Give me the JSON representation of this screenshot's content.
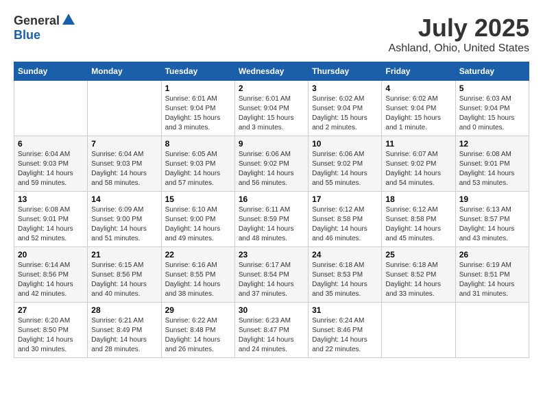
{
  "logo": {
    "general": "General",
    "blue": "Blue"
  },
  "title": "July 2025",
  "location": "Ashland, Ohio, United States",
  "weekdays": [
    "Sunday",
    "Monday",
    "Tuesday",
    "Wednesday",
    "Thursday",
    "Friday",
    "Saturday"
  ],
  "weeks": [
    [
      {
        "day": "",
        "sunrise": "",
        "sunset": "",
        "daylight": ""
      },
      {
        "day": "",
        "sunrise": "",
        "sunset": "",
        "daylight": ""
      },
      {
        "day": "1",
        "sunrise": "Sunrise: 6:01 AM",
        "sunset": "Sunset: 9:04 PM",
        "daylight": "Daylight: 15 hours and 3 minutes."
      },
      {
        "day": "2",
        "sunrise": "Sunrise: 6:01 AM",
        "sunset": "Sunset: 9:04 PM",
        "daylight": "Daylight: 15 hours and 3 minutes."
      },
      {
        "day": "3",
        "sunrise": "Sunrise: 6:02 AM",
        "sunset": "Sunset: 9:04 PM",
        "daylight": "Daylight: 15 hours and 2 minutes."
      },
      {
        "day": "4",
        "sunrise": "Sunrise: 6:02 AM",
        "sunset": "Sunset: 9:04 PM",
        "daylight": "Daylight: 15 hours and 1 minute."
      },
      {
        "day": "5",
        "sunrise": "Sunrise: 6:03 AM",
        "sunset": "Sunset: 9:04 PM",
        "daylight": "Daylight: 15 hours and 0 minutes."
      }
    ],
    [
      {
        "day": "6",
        "sunrise": "Sunrise: 6:04 AM",
        "sunset": "Sunset: 9:03 PM",
        "daylight": "Daylight: 14 hours and 59 minutes."
      },
      {
        "day": "7",
        "sunrise": "Sunrise: 6:04 AM",
        "sunset": "Sunset: 9:03 PM",
        "daylight": "Daylight: 14 hours and 58 minutes."
      },
      {
        "day": "8",
        "sunrise": "Sunrise: 6:05 AM",
        "sunset": "Sunset: 9:03 PM",
        "daylight": "Daylight: 14 hours and 57 minutes."
      },
      {
        "day": "9",
        "sunrise": "Sunrise: 6:06 AM",
        "sunset": "Sunset: 9:02 PM",
        "daylight": "Daylight: 14 hours and 56 minutes."
      },
      {
        "day": "10",
        "sunrise": "Sunrise: 6:06 AM",
        "sunset": "Sunset: 9:02 PM",
        "daylight": "Daylight: 14 hours and 55 minutes."
      },
      {
        "day": "11",
        "sunrise": "Sunrise: 6:07 AM",
        "sunset": "Sunset: 9:02 PM",
        "daylight": "Daylight: 14 hours and 54 minutes."
      },
      {
        "day": "12",
        "sunrise": "Sunrise: 6:08 AM",
        "sunset": "Sunset: 9:01 PM",
        "daylight": "Daylight: 14 hours and 53 minutes."
      }
    ],
    [
      {
        "day": "13",
        "sunrise": "Sunrise: 6:08 AM",
        "sunset": "Sunset: 9:01 PM",
        "daylight": "Daylight: 14 hours and 52 minutes."
      },
      {
        "day": "14",
        "sunrise": "Sunrise: 6:09 AM",
        "sunset": "Sunset: 9:00 PM",
        "daylight": "Daylight: 14 hours and 51 minutes."
      },
      {
        "day": "15",
        "sunrise": "Sunrise: 6:10 AM",
        "sunset": "Sunset: 9:00 PM",
        "daylight": "Daylight: 14 hours and 49 minutes."
      },
      {
        "day": "16",
        "sunrise": "Sunrise: 6:11 AM",
        "sunset": "Sunset: 8:59 PM",
        "daylight": "Daylight: 14 hours and 48 minutes."
      },
      {
        "day": "17",
        "sunrise": "Sunrise: 6:12 AM",
        "sunset": "Sunset: 8:58 PM",
        "daylight": "Daylight: 14 hours and 46 minutes."
      },
      {
        "day": "18",
        "sunrise": "Sunrise: 6:12 AM",
        "sunset": "Sunset: 8:58 PM",
        "daylight": "Daylight: 14 hours and 45 minutes."
      },
      {
        "day": "19",
        "sunrise": "Sunrise: 6:13 AM",
        "sunset": "Sunset: 8:57 PM",
        "daylight": "Daylight: 14 hours and 43 minutes."
      }
    ],
    [
      {
        "day": "20",
        "sunrise": "Sunrise: 6:14 AM",
        "sunset": "Sunset: 8:56 PM",
        "daylight": "Daylight: 14 hours and 42 minutes."
      },
      {
        "day": "21",
        "sunrise": "Sunrise: 6:15 AM",
        "sunset": "Sunset: 8:56 PM",
        "daylight": "Daylight: 14 hours and 40 minutes."
      },
      {
        "day": "22",
        "sunrise": "Sunrise: 6:16 AM",
        "sunset": "Sunset: 8:55 PM",
        "daylight": "Daylight: 14 hours and 38 minutes."
      },
      {
        "day": "23",
        "sunrise": "Sunrise: 6:17 AM",
        "sunset": "Sunset: 8:54 PM",
        "daylight": "Daylight: 14 hours and 37 minutes."
      },
      {
        "day": "24",
        "sunrise": "Sunrise: 6:18 AM",
        "sunset": "Sunset: 8:53 PM",
        "daylight": "Daylight: 14 hours and 35 minutes."
      },
      {
        "day": "25",
        "sunrise": "Sunrise: 6:18 AM",
        "sunset": "Sunset: 8:52 PM",
        "daylight": "Daylight: 14 hours and 33 minutes."
      },
      {
        "day": "26",
        "sunrise": "Sunrise: 6:19 AM",
        "sunset": "Sunset: 8:51 PM",
        "daylight": "Daylight: 14 hours and 31 minutes."
      }
    ],
    [
      {
        "day": "27",
        "sunrise": "Sunrise: 6:20 AM",
        "sunset": "Sunset: 8:50 PM",
        "daylight": "Daylight: 14 hours and 30 minutes."
      },
      {
        "day": "28",
        "sunrise": "Sunrise: 6:21 AM",
        "sunset": "Sunset: 8:49 PM",
        "daylight": "Daylight: 14 hours and 28 minutes."
      },
      {
        "day": "29",
        "sunrise": "Sunrise: 6:22 AM",
        "sunset": "Sunset: 8:48 PM",
        "daylight": "Daylight: 14 hours and 26 minutes."
      },
      {
        "day": "30",
        "sunrise": "Sunrise: 6:23 AM",
        "sunset": "Sunset: 8:47 PM",
        "daylight": "Daylight: 14 hours and 24 minutes."
      },
      {
        "day": "31",
        "sunrise": "Sunrise: 6:24 AM",
        "sunset": "Sunset: 8:46 PM",
        "daylight": "Daylight: 14 hours and 22 minutes."
      },
      {
        "day": "",
        "sunrise": "",
        "sunset": "",
        "daylight": ""
      },
      {
        "day": "",
        "sunrise": "",
        "sunset": "",
        "daylight": ""
      }
    ]
  ]
}
